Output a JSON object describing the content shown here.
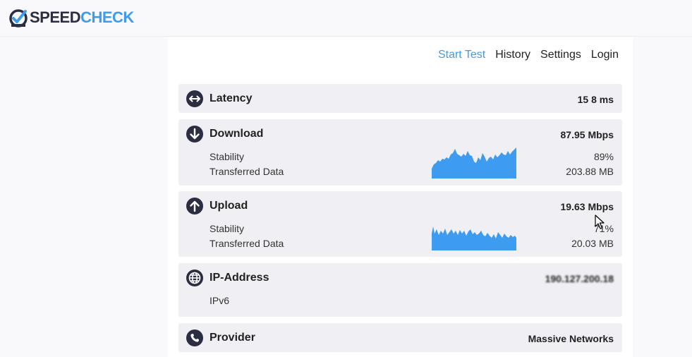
{
  "brand": {
    "part1": "SPEED",
    "part2": "CHECK"
  },
  "nav": {
    "start": "Start Test",
    "history": "History",
    "settings": "Settings",
    "login": "Login"
  },
  "latency": {
    "title": "Latency",
    "value": "15 8 ms"
  },
  "download": {
    "title": "Download",
    "value": "87.95 Mbps",
    "stability_label": "Stability",
    "stability_value": "89%",
    "transferred_label": "Transferred Data",
    "transferred_value": "203.88 MB"
  },
  "upload": {
    "title": "Upload",
    "value": "19.63 Mbps",
    "stability_label": "Stability",
    "stability_value": "71%",
    "transferred_label": "Transferred Data",
    "transferred_value": "20.03 MB"
  },
  "ip": {
    "title": "IP-Address",
    "value": "190.127.200.18",
    "version": "IPv6"
  },
  "provider": {
    "title": "Provider",
    "value": "Massive Networks"
  },
  "colors": {
    "accent": "#3d9bf0",
    "dark": "#2b2d42",
    "card": "#f0f0f4"
  }
}
